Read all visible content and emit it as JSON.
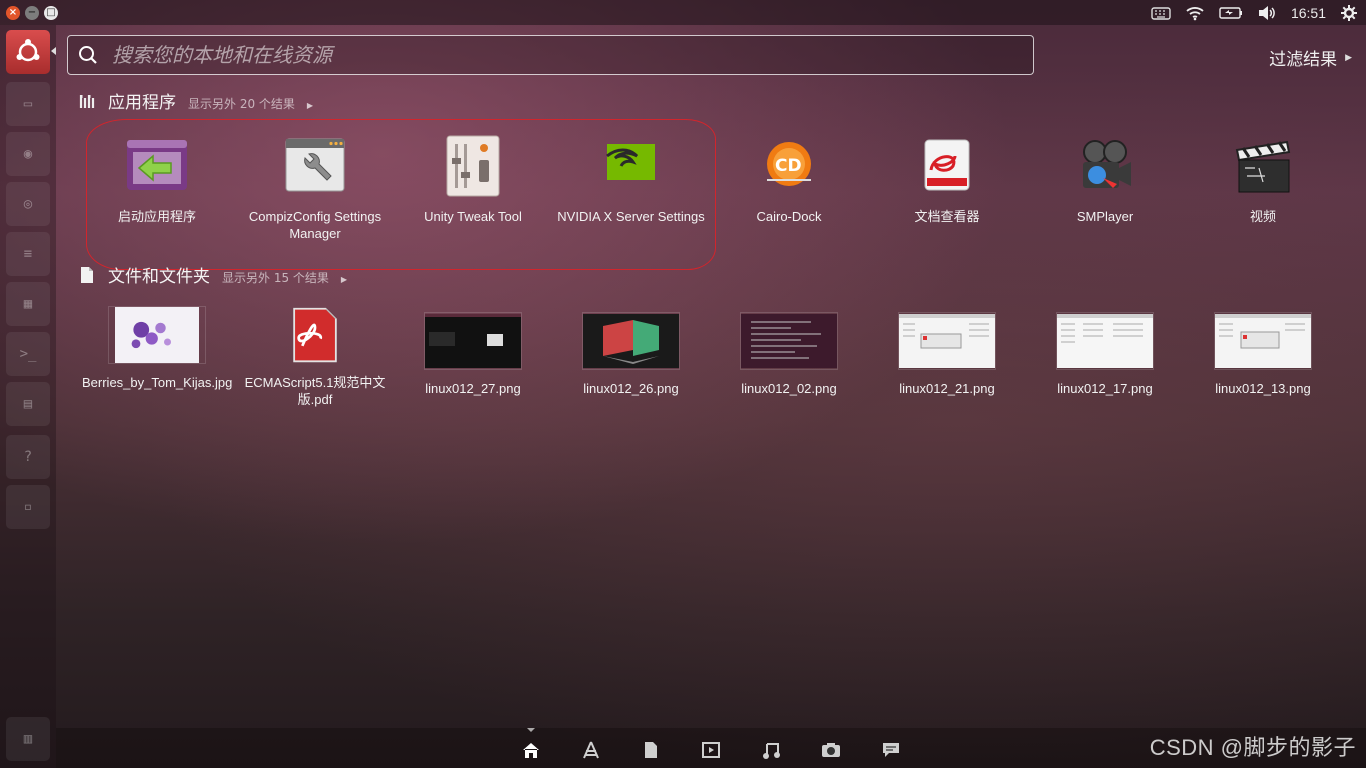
{
  "window_controls": {
    "close": "×",
    "minimize": "−",
    "maximize": "□"
  },
  "top_panel": {
    "time": "16:51",
    "indicators": [
      "keyboard-icon",
      "wifi-icon",
      "battery-icon",
      "volume-icon",
      "gear-icon"
    ]
  },
  "launcher": {
    "items": [
      "dash-home-icon",
      "files-icon",
      "firefox-icon",
      "chrome-icon",
      "writer-icon",
      "calc-icon",
      "terminal-icon",
      "impress-icon",
      "unknown-app-icon",
      "workspace-icon",
      "trash-icon"
    ],
    "active_arrow": true
  },
  "search": {
    "placeholder": "搜索您的本地和在线资源",
    "value": ""
  },
  "filter": {
    "label": "过滤结果"
  },
  "applications": {
    "title": "应用程序",
    "more": "显示另外 20 个结果",
    "items": [
      {
        "label": "启动应用程序",
        "icon": "startup-apps-icon"
      },
      {
        "label": "CompizConfig Settings Manager",
        "icon": "ccsm-icon"
      },
      {
        "label": "Unity Tweak Tool",
        "icon": "unity-tweak-icon"
      },
      {
        "label": "NVIDIA X Server Settings",
        "icon": "nvidia-icon"
      },
      {
        "label": "Cairo-Dock",
        "icon": "cairo-dock-icon"
      },
      {
        "label": "文档查看器",
        "icon": "evince-icon"
      },
      {
        "label": "SMPlayer",
        "icon": "smplayer-icon"
      },
      {
        "label": "视频",
        "icon": "totem-icon"
      }
    ]
  },
  "files": {
    "title": "文件和文件夹",
    "more": "显示另外 15 个结果",
    "items": [
      {
        "label": "Berries_by_Tom_Kijas.jpg"
      },
      {
        "label": "ECMAScript5.1规范中文版.pdf"
      },
      {
        "label": "linux012_27.png"
      },
      {
        "label": "linux012_26.png"
      },
      {
        "label": "linux012_02.png"
      },
      {
        "label": "linux012_21.png"
      },
      {
        "label": "linux012_17.png"
      },
      {
        "label": "linux012_13.png"
      }
    ]
  },
  "lens_bar": {
    "lenses": [
      "home-lens-icon",
      "applications-lens-icon",
      "files-lens-icon",
      "video-lens-icon",
      "music-lens-icon",
      "photo-lens-icon",
      "social-lens-icon"
    ],
    "active": "home-lens-icon"
  },
  "watermark": "CSDN @脚步的影子",
  "colors": {
    "annotation_outline": "#d2252c",
    "launcher_bfb": "#c23b3b"
  }
}
